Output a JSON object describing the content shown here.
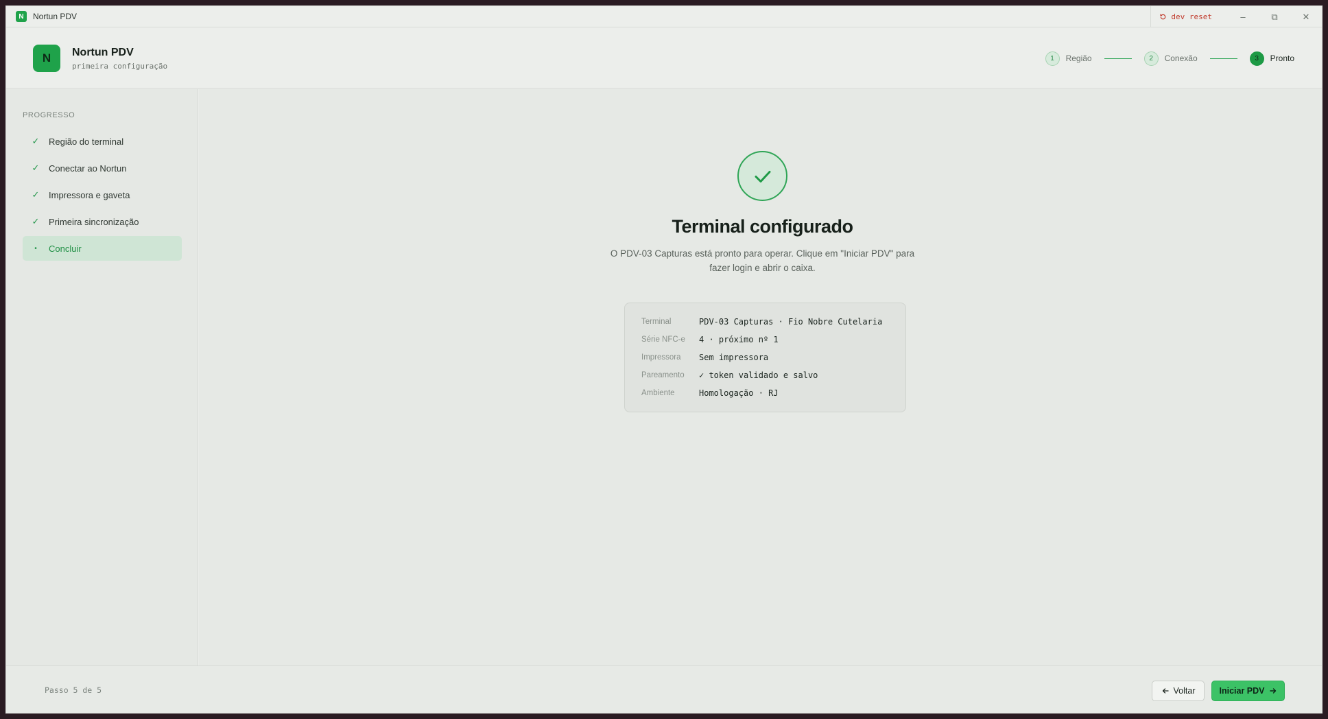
{
  "app": {
    "window_title": "Nortun PDV",
    "logo_letter": "N"
  },
  "titlebar": {
    "dev_reset_label": "dev reset",
    "minimize": "–",
    "restore": "⧉",
    "close": "✕"
  },
  "header": {
    "brand_name": "Nortun PDV",
    "brand_subtitle": "primeira configuração",
    "steps": [
      {
        "num": "1",
        "label": "Região"
      },
      {
        "num": "2",
        "label": "Conexão"
      },
      {
        "num": "3",
        "label": "Pronto"
      }
    ]
  },
  "sidebar": {
    "heading": "PROGRESSO",
    "items": [
      {
        "mark": "✓",
        "label": "Região do terminal"
      },
      {
        "mark": "✓",
        "label": "Conectar ao Nortun"
      },
      {
        "mark": "✓",
        "label": "Impressora e gaveta"
      },
      {
        "mark": "✓",
        "label": "Primeira sincronização"
      },
      {
        "mark": "•",
        "label": "Concluir"
      }
    ]
  },
  "main": {
    "title": "Terminal configurado",
    "description": "O PDV-03 Capturas está pronto para operar. Clique em \"Iniciar PDV\" para fazer login e abrir o caixa.",
    "summary": [
      {
        "label": "Terminal",
        "value": "PDV-03 Capturas · Fio Nobre Cutelaria"
      },
      {
        "label": "Série NFC-e",
        "value": "4 · próximo nº 1"
      },
      {
        "label": "Impressora",
        "value": "Sem impressora"
      },
      {
        "label": "Pareamento",
        "value": "✓ token validado e salvo"
      },
      {
        "label": "Ambiente",
        "value": "Homologação · RJ"
      }
    ]
  },
  "footer": {
    "step_text": "Passo 5 de 5",
    "back_label": "Voltar",
    "start_label": "Iniciar PDV"
  },
  "colors": {
    "accent": "#1fa24a",
    "button_primary": "#3cc266",
    "danger": "#c0392b"
  }
}
